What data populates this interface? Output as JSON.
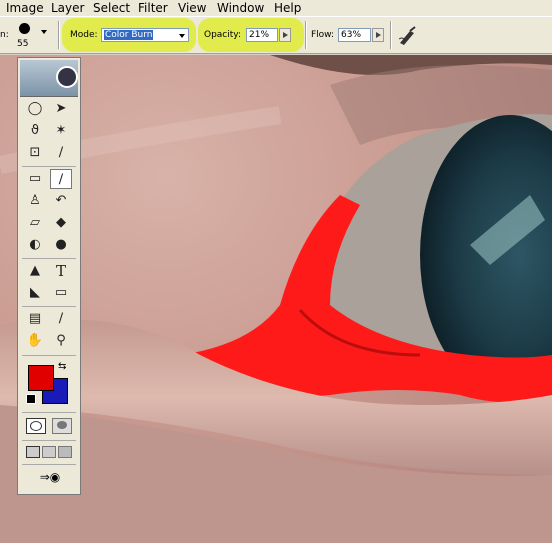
{
  "menu": {
    "items": [
      "Image",
      "Layer",
      "Select",
      "Filter",
      "View",
      "Window",
      "Help"
    ]
  },
  "options": {
    "brush_prefix": "n:",
    "brush_size": "55",
    "mode_label": "Mode:",
    "mode_value": "Color Burn",
    "opacity_label": "Opacity:",
    "opacity_value": "21%",
    "flow_label": "Flow:",
    "flow_value": "63%"
  },
  "colors": {
    "foreground": "#e00000",
    "background": "#1a1ab8",
    "highlight": "#e0ec44",
    "red_overlay": "#ff1a1a"
  },
  "toolbox": {
    "tools": [
      "marquee-icon",
      "move-icon",
      "lasso-icon",
      "magic-wand-icon",
      "crop-icon",
      "slice-icon",
      "healing-brush-icon",
      "brush-icon",
      "clone-stamp-icon",
      "history-brush-icon",
      "eraser-icon",
      "paint-bucket-icon",
      "blur-icon",
      "dodge-icon",
      "path-select-icon",
      "type-icon",
      "pen-icon",
      "rectangle-icon",
      "notes-icon",
      "eyedropper-icon",
      "hand-icon",
      "zoom-icon"
    ]
  }
}
